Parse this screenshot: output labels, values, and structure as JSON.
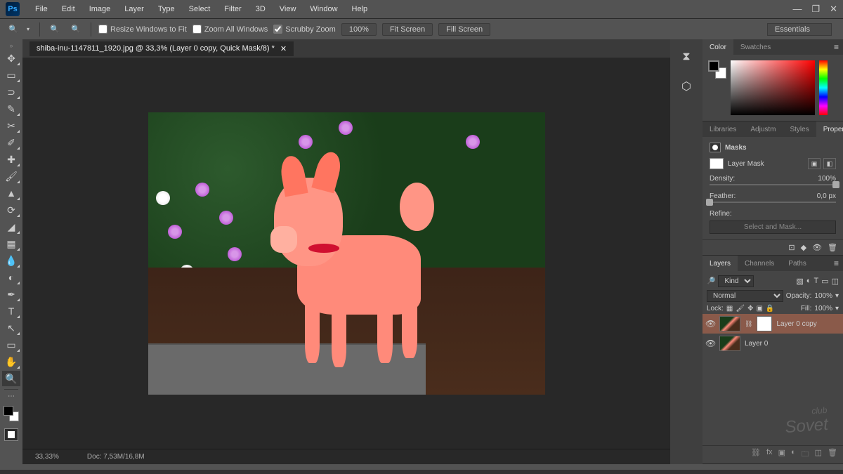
{
  "menubar": [
    "File",
    "Edit",
    "Image",
    "Layer",
    "Type",
    "Select",
    "Filter",
    "3D",
    "View",
    "Window",
    "Help"
  ],
  "optionsbar": {
    "resize_windows": "Resize Windows to Fit",
    "zoom_all": "Zoom All Windows",
    "scrubby": "Scrubby Zoom",
    "zoom_pct": "100%",
    "fit": "Fit Screen",
    "fill": "Fill Screen",
    "workspace": "Essentials"
  },
  "document": {
    "tab_title": "shiba-inu-1147811_1920.jpg @ 33,3% (Layer 0 copy, Quick Mask/8) *",
    "zoom_status": "33,33%",
    "doc_size": "Doc: 7,53M/16,8M"
  },
  "panels": {
    "color": {
      "tabs": [
        "Color",
        "Swatches"
      ]
    },
    "properties": {
      "tabs": [
        "Libraries",
        "Adjustm",
        "Styles",
        "Properties"
      ],
      "heading": "Masks",
      "mask_label": "Layer Mask",
      "density_label": "Density:",
      "density_value": "100%",
      "feather_label": "Feather:",
      "feather_value": "0,0 px",
      "refine_label": "Refine:",
      "refine_btn": "Select and Mask..."
    },
    "layers": {
      "tabs": [
        "Layers",
        "Channels",
        "Paths"
      ],
      "kind": "Kind",
      "blend_mode": "Normal",
      "opacity_label": "Opacity:",
      "opacity_value": "100%",
      "lock_label": "Lock:",
      "fill_label": "Fill:",
      "fill_value": "100%",
      "items": [
        {
          "name": "Layer 0 copy",
          "selected": true,
          "has_mask": true
        },
        {
          "name": "Layer 0",
          "selected": false,
          "has_mask": false
        }
      ]
    }
  },
  "watermark": {
    "small": "club",
    "big": "Sovet"
  }
}
